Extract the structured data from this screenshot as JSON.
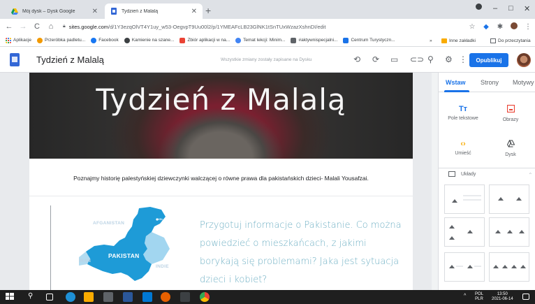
{
  "browser": {
    "tabs": [
      {
        "title": "Mój dysk – Dysk Google",
        "active": false
      },
      {
        "title": "Tydzień z Malalą",
        "active": true
      }
    ],
    "new_tab": "+",
    "window_controls": [
      "–",
      "□",
      "✕"
    ],
    "url_domain": "sites.google.com",
    "url_path": "/d/1Y3ezqOlVT4Y1uy_w53-OegvpT9Uu00l2/p/1YMEAFcLB23GlNK1tSnTUxWzazXshnDI/edit",
    "bookmarks": [
      {
        "label": "Aplikacje",
        "color": "#3c4043"
      },
      {
        "label": "Przeróbka padletu...",
        "color": "#f29900"
      },
      {
        "label": "Facebook",
        "color": "#1877f2"
      },
      {
        "label": "Kamienie na szane...",
        "color": "#5f6368"
      },
      {
        "label": "Zbiór aplikacji w na...",
        "color": "#ea4335"
      },
      {
        "label": "Temat lekcji: Minim...",
        "color": "#4285f4"
      },
      {
        "label": "#aktywnispecjalni...",
        "color": "#5f6368"
      },
      {
        "label": "Centrum Turystyczn...",
        "color": "#1a73e8"
      }
    ],
    "bookmarks_more": "»",
    "other_bookmarks": "Inne zakładki",
    "reading_list": "Do przeczytania"
  },
  "toolbar": {
    "site_title": "Tydzień z Malalą",
    "save_status": "Wszystkie zmiany zostały zapisane na Dysku",
    "publish_label": "Opublikuj",
    "accent": "#1a73e8"
  },
  "page": {
    "hero_title": "Tydzień z Malalą",
    "intro": "Poznajmy historię palestyńskiej dziewczynki walczącej o równe prawa dla pakistańskich dzieci- Malali Yousafzai.",
    "paragraph": "Przygotuj informacje o Pakistanie. Co można powiedzieć o mieszkańcach, z jakimi borykają się problemami? Jaka jest sytuacja dzieci i kobiet?",
    "map_labels": {
      "afghanistan": "AFGANISTAN",
      "islamabad": "ISLAMABAD",
      "pakistan": "PAKISTAN",
      "iran": "IRAN",
      "india": "INDIE"
    },
    "map_color": "#1e9bd7"
  },
  "panel": {
    "tabs": [
      "Wstaw",
      "Strony",
      "Motywy"
    ],
    "active_tab": "Wstaw",
    "tiles": [
      {
        "label": "Pole tekstowe",
        "icon": "text-box-icon"
      },
      {
        "label": "Obrazy",
        "icon": "image-icon"
      },
      {
        "label": "Umieść",
        "icon": "embed-icon"
      },
      {
        "label": "Dysk",
        "icon": "drive-icon"
      }
    ],
    "layouts_label": "Układy"
  },
  "taskbar": {
    "language": "POL",
    "language_sub": "PLR",
    "time": "13:50",
    "date": "2021-06-14"
  }
}
